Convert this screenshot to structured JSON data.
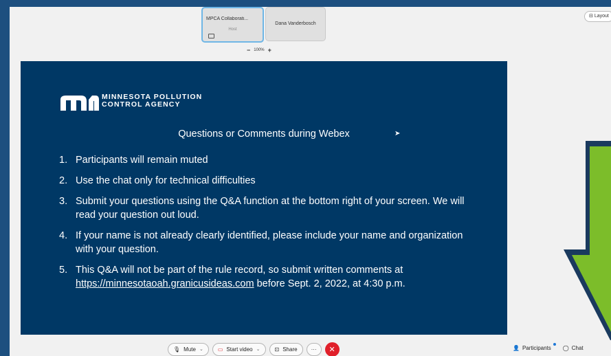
{
  "participants_strip": {
    "host_tile": {
      "name": "MPCA Collaborati...",
      "role": "Host"
    },
    "other_tile": {
      "name": "Dana Vanderbosch"
    }
  },
  "zoom": {
    "minus": "−",
    "level": "100%",
    "plus": "+"
  },
  "layout_button": "Layout",
  "slide": {
    "logo_text": "MINNESOTA POLLUTION\nCONTROL AGENCY",
    "title": "Questions or Comments during Webex",
    "items": [
      {
        "num": "1.",
        "text": "Participants will remain muted"
      },
      {
        "num": "2.",
        "text": "Use the chat only for technical difficulties"
      },
      {
        "num": "3.",
        "text": "Submit your questions using the Q&A function at the bottom right of your screen. We will read your question out loud."
      },
      {
        "num": "4.",
        "text": "If your name is not already clearly identified, please include your name and organization with your question."
      },
      {
        "num": "5.",
        "text_before": "This Q&A will not be part of the rule record, so submit written comments at",
        "link": "https://minnesotaoah.granicusideas.com",
        "text_after": " before Sept. 2, 2022, at 4:30 p.m."
      }
    ]
  },
  "toolbar": {
    "mute": "Mute",
    "start_video": "Start video",
    "share": "Share",
    "more": "···",
    "end": "✕"
  },
  "right_controls": {
    "participants": "Participants",
    "chat": "Chat"
  },
  "colors": {
    "slide_bg": "#003865",
    "outer_bg": "#1d4f7f",
    "arrow_green": "#7cbd2a",
    "end_red": "#e0202a"
  }
}
